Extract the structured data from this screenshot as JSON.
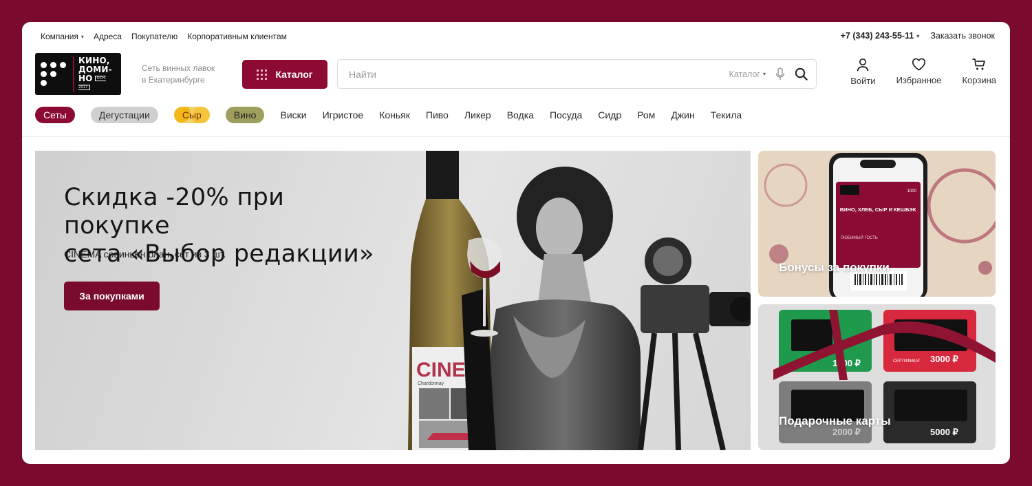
{
  "topbar": {
    "nav": [
      {
        "label": "Компания",
        "has_caret": true
      },
      {
        "label": "Адреса"
      },
      {
        "label": "Покупателю"
      },
      {
        "label": "Корпоративным клиентам"
      }
    ],
    "phone": "+7 (343) 243-55-11",
    "callback": "Заказать звонок"
  },
  "logo": {
    "line1": "КИНО,",
    "line2": "ДОМИ-",
    "line3": "НО",
    "badge": "ОСН. 2017"
  },
  "tagline": {
    "line1": "Сеть винных лавок",
    "line2": "в Екатеринбурге"
  },
  "catalog_button": "Каталог",
  "search": {
    "placeholder": "Найти",
    "scope": "Каталог"
  },
  "header_actions": [
    {
      "label": "Войти",
      "icon": "user-icon"
    },
    {
      "label": "Избранное",
      "icon": "heart-icon"
    },
    {
      "label": "Корзина",
      "icon": "cart-icon"
    }
  ],
  "categories": {
    "pills": [
      "Сеты",
      "Дегустации",
      "Сыр",
      "Вино"
    ],
    "links": [
      "Виски",
      "Игристое",
      "Коньяк",
      "Пиво",
      "Ликер",
      "Водка",
      "Посуда",
      "Сидр",
      "Ром",
      "Джин",
      "Текила"
    ]
  },
  "hero": {
    "title_line1": "Скидка -20% при покупке",
    "title_line2": "сета «Выбор редакции»",
    "subtitle": "CINEMA совиньен блан, сет из 3 шт.",
    "button": "За покупками",
    "bottle_label": "CINEM",
    "bottle_sublabel": "Chardonnay"
  },
  "promos": {
    "bonus": {
      "label": "Бонусы за покупки",
      "phone_text": "ВИНО, ХЛЕБ, СЫР И КЕШБЭК",
      "phone_subtext": "ЛЮБИМЫЙ ГОСТЬ",
      "phone_count": "1000"
    },
    "gift": {
      "label": "Подарочные карты",
      "cards": [
        {
          "amount": "1000 ₽",
          "color": "#1f9a4d"
        },
        {
          "amount": "3000 ₽",
          "color": "#d8283d"
        },
        {
          "amount": "2000 ₽",
          "color": "#7d7d7d"
        },
        {
          "amount": "5000 ₽",
          "color": "#2a2a2a"
        }
      ],
      "card_caption": "СЕРТИФИКАТ"
    }
  },
  "colors": {
    "brand": "#8d0b33",
    "page_bg": "#7a0a2e"
  }
}
